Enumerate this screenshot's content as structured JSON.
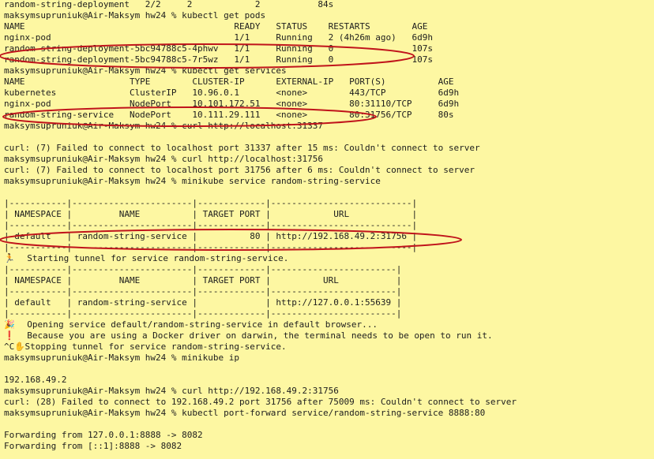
{
  "lines": [
    "random-string-deployment   2/2     2            2           84s",
    "maksymsupruniuk@Air-Maksym hw24 % kubectl get pods",
    "NAME                                        READY   STATUS    RESTARTS        AGE",
    "nginx-pod                                   1/1     Running   2 (4h26m ago)   6d9h",
    "random-string-deployment-5bc94788c5-4phwv   1/1     Running   0               107s",
    "random-string-deployment-5bc94788c5-7r5wz   1/1     Running   0               107s",
    "maksymsupruniuk@Air-Maksym hw24 % kubectl get services",
    "NAME                    TYPE        CLUSTER-IP      EXTERNAL-IP   PORT(S)          AGE",
    "kubernetes              ClusterIP   10.96.0.1       <none>        443/TCP          6d9h",
    "nginx-pod               NodePort    10.101.172.51   <none>        80:31110/TCP     6d9h",
    "random-string-service   NodePort    10.111.29.111   <none>        80:31756/TCP     80s",
    "maksymsupruniuk@Air-Maksym hw24 % curl http://localhost:31337",
    "",
    "curl: (7) Failed to connect to localhost port 31337 after 15 ms: Couldn't connect to server",
    "maksymsupruniuk@Air-Maksym hw24 % curl http://localhost:31756",
    "curl: (7) Failed to connect to localhost port 31756 after 6 ms: Couldn't connect to server",
    "maksymsupruniuk@Air-Maksym hw24 % minikube service random-string-service",
    "",
    "|-----------|-----------------------|-------------|---------------------------|",
    "| NAMESPACE |         NAME          | TARGET PORT |            URL            |",
    "|-----------|-----------------------|-------------|---------------------------|",
    "| default   | random-string-service |          80 | http://192.168.49.2:31756 |",
    "|-----------|-----------------------|-------------|---------------------------|",
    "  Starting tunnel for service random-string-service.",
    "|-----------|-----------------------|-------------|------------------------|",
    "| NAMESPACE |         NAME          | TARGET PORT |          URL           |",
    "|-----------|-----------------------|-------------|------------------------|",
    "| default   | random-string-service |             | http://127.0.0.1:55639 |",
    "|-----------|-----------------------|-------------|------------------------|",
    "  Opening service default/random-string-service in default browser...",
    "  Because you are using a Docker driver on darwin, the terminal needs to be open to run it.",
    "^C  Stopping tunnel for service random-string-service.",
    "maksymsupruniuk@Air-Maksym hw24 % minikube ip",
    "",
    "192.168.49.2",
    "maksymsupruniuk@Air-Maksym hw24 % curl http://192.168.49.2:31756",
    "curl: (28) Failed to connect to 192.168.49.2 port 31756 after 75009 ms: Couldn't connect to server",
    "maksymsupruniuk@Air-Maksym hw24 % kubectl port-forward service/random-string-service 8888:80",
    "",
    "Forwarding from 127.0.0.1:8888 -> 8082",
    "Forwarding from [::1]:8888 -> 8082"
  ],
  "icons": {
    "tunnel": "🏃",
    "party": "🎉",
    "warning": "❗",
    "hand": "✋"
  },
  "colors": {
    "background": "#fdf7a2",
    "text": "#1d1d1d",
    "annotation": "#c0141b"
  }
}
